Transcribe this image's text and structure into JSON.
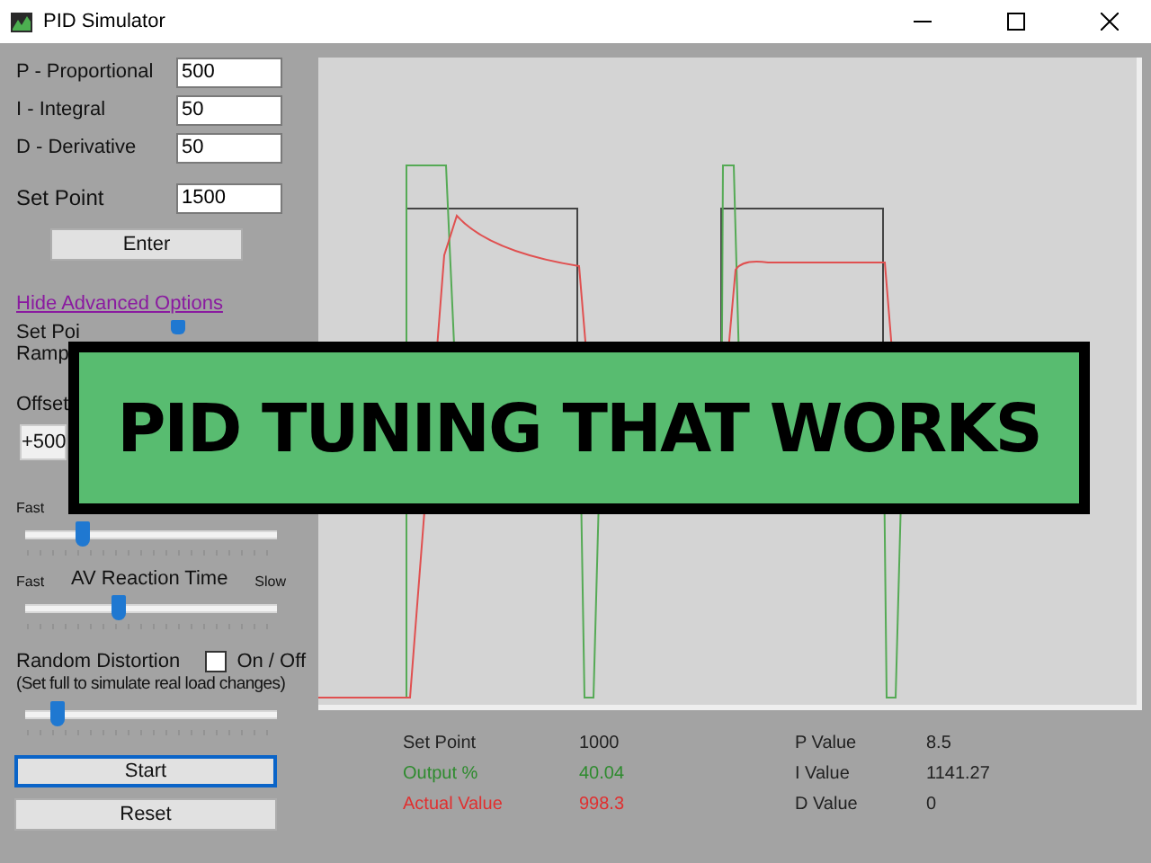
{
  "window": {
    "title": "PID Simulator"
  },
  "gains": [
    {
      "label": "P - Proportional",
      "value": "500"
    },
    {
      "label": "I - Integral",
      "value": "50"
    },
    {
      "label": "D - Derivative",
      "value": "50"
    }
  ],
  "set_point": {
    "label": "Set Point",
    "value": "1500",
    "button": "Enter"
  },
  "advanced_link": "Hide Advanced Options",
  "ramp": {
    "label_1": "Set Poi",
    "label_2": "Ramp"
  },
  "offset": {
    "label": "Offset",
    "buttons": [
      "+500"
    ]
  },
  "graph_speed": {
    "left": "Fast",
    "level": 0.23
  },
  "av_reaction": {
    "label": "AV Reaction Time",
    "left": "Fast",
    "right": "Slow",
    "level": 0.37
  },
  "distortion": {
    "label": "Random Distortion",
    "toggle": "On / Off",
    "checked": false,
    "note": "(Set full to simulate real load changes)",
    "level": 0.13
  },
  "actions": [
    {
      "label": "Start",
      "focused": true
    },
    {
      "label": "Reset",
      "focused": false
    }
  ],
  "readouts": [
    {
      "label": "Set Point",
      "value": "1000",
      "color": "#222222"
    },
    {
      "label": "Output  %",
      "value": "40.04",
      "color": "#2e8b2e"
    },
    {
      "label": "Actual Value",
      "value": "998.3",
      "color": "#e03030"
    }
  ],
  "terms": [
    {
      "label": "P Value",
      "value": "8.5"
    },
    {
      "label": "I Value",
      "value": "1141.27"
    },
    {
      "label": "D Value",
      "value": "0"
    }
  ],
  "banner": {
    "text": "PID TUNING THAT WORKS"
  }
}
